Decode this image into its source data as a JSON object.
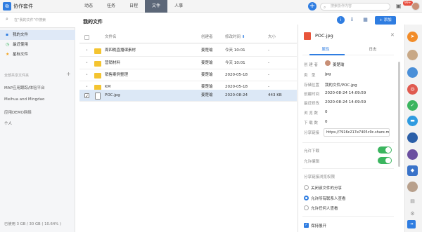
{
  "header": {
    "app_logo": "⧉",
    "app_name": "协作套件",
    "nav": [
      "动态",
      "任务",
      "日程",
      "文件",
      "人事"
    ],
    "active_nav": "文件",
    "search_placeholder": "搜索协作内容",
    "notification_badge": "99+"
  },
  "sidebar": {
    "search_placeholder": "在“我的文件”中搜索",
    "items": [
      {
        "label": "我的文件",
        "icon": "folder-icon"
      },
      {
        "label": "最近使用",
        "icon": "clock-icon"
      },
      {
        "label": "星标文件",
        "icon": "star-icon"
      }
    ],
    "shared_section_label": "全部共享文件夹",
    "projects": [
      "MAP应用跟踪/体验平台",
      "Meihua and Mingdao",
      "应用DEMO网络",
      "个人"
    ],
    "storage": "已使用 3 GB / 30 GB ( 10.64% )"
  },
  "main": {
    "title": "我的文件",
    "upload_label": "+ 添加",
    "columns": {
      "name": "文件名",
      "creator": "创建者",
      "time": "修改时间",
      "size": "大小"
    },
    "rows": [
      {
        "name": "周四晚直播课素材",
        "type": "folder",
        "creator": "姜楚瑜",
        "time": "今天 10:01",
        "size": "-"
      },
      {
        "name": "营销材料",
        "type": "folder",
        "creator": "姜楚瑜",
        "time": "今天 10:01",
        "size": "-"
      },
      {
        "name": "销售案例整理",
        "type": "folder",
        "creator": "姜楚瑜",
        "time": "2020-05-18",
        "size": "-"
      },
      {
        "name": "KM",
        "type": "folder",
        "creator": "姜楚瑜",
        "time": "2020-05-18",
        "size": "-"
      },
      {
        "name": "POC.jpg",
        "type": "file",
        "creator": "姜楚瑜",
        "time": "2020-08-24",
        "size": "443 KB"
      }
    ]
  },
  "detail": {
    "filename": "POC.jpg",
    "tabs": [
      "属性",
      "日志"
    ],
    "props": [
      {
        "label": "创 建 者",
        "value": "姜楚瑜"
      },
      {
        "label": "类　型",
        "value": "jpg"
      },
      {
        "label": "存储位置",
        "value": "我的文件/POC.jpg"
      },
      {
        "label": "创建时间",
        "value": "2020-08-24 14:09:59"
      },
      {
        "label": "最近修改",
        "value": "2020-08-24 14:09:59"
      },
      {
        "label": "浏 览 数",
        "value": "0"
      },
      {
        "label": "下 载 数",
        "value": "0"
      }
    ],
    "share_label": "分享链接",
    "share_link": "https://7916c217e7405c9c.share.m",
    "allow_download": "允许下载",
    "allow_edit": "允许编辑",
    "share_scope_title": "分享链接浏览权限",
    "radios": [
      "关闭该文件的分享",
      "允许所有联系人查看",
      "允许任何人查看"
    ],
    "keep_open": "保持展开"
  },
  "colors": {
    "accent": "#2f7de1",
    "folder": "#f4c430",
    "toggle": "#3bb55f",
    "selected_row": "#dce8f6"
  }
}
